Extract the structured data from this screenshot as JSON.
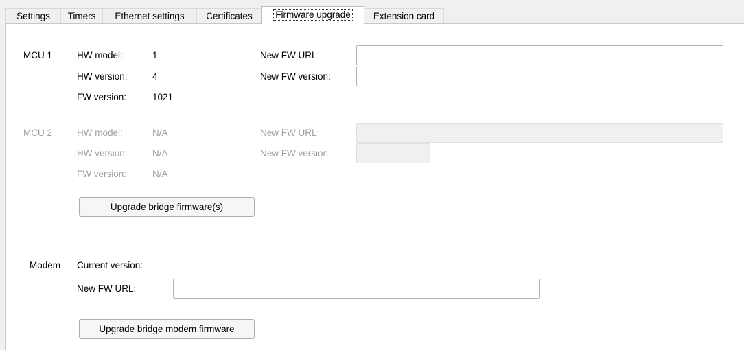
{
  "tabs": [
    {
      "label": "Settings"
    },
    {
      "label": "Timers"
    },
    {
      "label": "Ethernet settings"
    },
    {
      "label": "Certificates"
    },
    {
      "label": "Firmware upgrade",
      "active": true
    },
    {
      "label": "Extension card"
    }
  ],
  "mcu1": {
    "title": "MCU 1",
    "hw_model_label": "HW model:",
    "hw_model_value": "1",
    "hw_version_label": "HW version:",
    "hw_version_value": "4",
    "fw_version_label": "FW version:",
    "fw_version_value": "1021",
    "new_fw_url_label": "New FW URL:",
    "new_fw_url_value": "",
    "new_fw_version_label": "New FW version:",
    "new_fw_version_value": ""
  },
  "mcu2": {
    "title": "MCU 2",
    "hw_model_label": "HW model:",
    "hw_model_value": "N/A",
    "hw_version_label": "HW version:",
    "hw_version_value": "N/A",
    "fw_version_label": "FW version:",
    "fw_version_value": "N/A",
    "new_fw_url_label": "New FW URL:",
    "new_fw_url_value": "",
    "new_fw_version_label": "New FW version:",
    "new_fw_version_value": ""
  },
  "upgrade_bridge_button": "Upgrade bridge firmware(s)",
  "modem": {
    "title": "Modem",
    "current_version_label": "Current version:",
    "current_version_value": "",
    "new_fw_url_label": "New FW URL:",
    "new_fw_url_value": ""
  },
  "upgrade_modem_button": "Upgrade bridge modem firmware"
}
